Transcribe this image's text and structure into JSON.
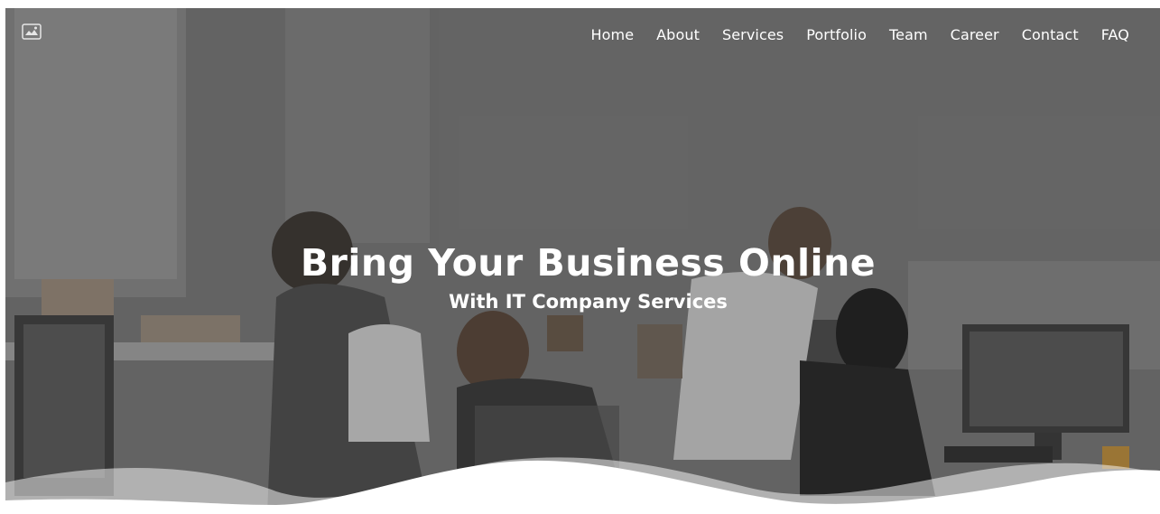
{
  "header": {
    "logo_icon": "broken-image-icon",
    "nav": [
      {
        "label": "Home"
      },
      {
        "label": "About"
      },
      {
        "label": "Services"
      },
      {
        "label": "Portfolio"
      },
      {
        "label": "Team"
      },
      {
        "label": "Career"
      },
      {
        "label": "Contact"
      },
      {
        "label": "FAQ"
      }
    ]
  },
  "hero": {
    "title": "Bring Your Business Online",
    "subtitle": "With IT Company Services"
  },
  "colors": {
    "text": "#ffffff",
    "overlay": "#5a5a5a",
    "wave": "#ffffff"
  }
}
